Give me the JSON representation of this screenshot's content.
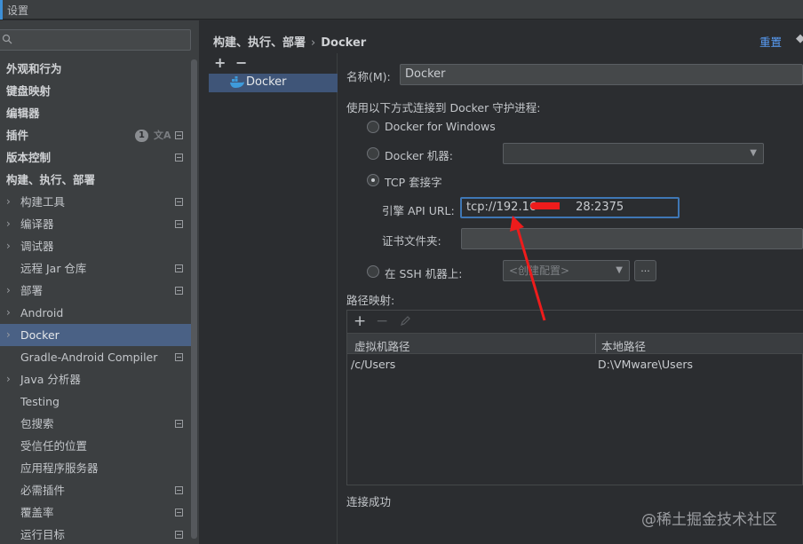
{
  "window": {
    "title": "设置"
  },
  "search": {
    "placeholder": ""
  },
  "sidebar": {
    "items": [
      {
        "label": "外观和行为",
        "bold": true
      },
      {
        "label": "键盘映射",
        "bold": true
      },
      {
        "label": "编辑器",
        "bold": true
      },
      {
        "label": "插件",
        "bold": true,
        "badge": "1"
      },
      {
        "label": "版本控制",
        "bold": true
      },
      {
        "label": "构建、执行、部署",
        "bold": true
      },
      {
        "label": "构建工具"
      },
      {
        "label": "编译器"
      },
      {
        "label": "调试器"
      },
      {
        "label": "远程 Jar 仓库"
      },
      {
        "label": "部署"
      },
      {
        "label": "Android"
      },
      {
        "label": "Docker",
        "selected": true
      },
      {
        "label": "Gradle-Android Compiler"
      },
      {
        "label": "Java 分析器"
      },
      {
        "label": "Testing"
      },
      {
        "label": "包搜索"
      },
      {
        "label": "受信任的位置"
      },
      {
        "label": "应用程序服务器"
      },
      {
        "label": "必需插件"
      },
      {
        "label": "覆盖率"
      },
      {
        "label": "运行目标"
      }
    ]
  },
  "header": {
    "breadcrumb_parent": "构建、执行、部署",
    "breadcrumb_sep": "›",
    "breadcrumb_current": "Docker",
    "reset_label": "重置"
  },
  "servers": {
    "add": "+",
    "remove": "−",
    "items": [
      {
        "label": "Docker"
      }
    ]
  },
  "form": {
    "name_label": "名称(M):",
    "name_value": "Docker",
    "connect_label": "使用以下方式连接到 Docker 守护进程:",
    "option_windows": "Docker for Windows",
    "option_machine": "Docker 机器:",
    "option_tcp": "TCP 套接字",
    "engine_url_label": "引擎 API URL:",
    "engine_url_value_start": "tcp://192.16",
    "engine_url_value_end": "28:2375",
    "cert_label": "证书文件夹:",
    "cert_value": "",
    "option_ssh": "在 SSH 机器上:",
    "ssh_combo": "<创建配置>",
    "ssh_browse": "...",
    "path_mapping_label": "路径映射:",
    "selected_option": "tcp"
  },
  "mapping_table": {
    "columns": [
      "虚拟机路径",
      "本地路径"
    ],
    "rows": [
      [
        "/c/Users",
        "D:\\VMware\\Users"
      ]
    ]
  },
  "status": {
    "text": "连接成功"
  },
  "watermark": {
    "text": "@稀土掘金技术社区"
  },
  "colors": {
    "accent": "#589df6",
    "selection": "#4a6185",
    "annotation": "#ee1c1c"
  }
}
